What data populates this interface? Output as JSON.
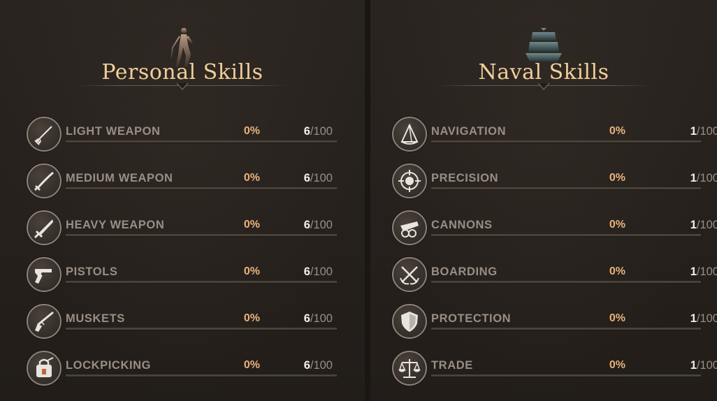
{
  "personal": {
    "title": "Personal Skills",
    "header_icon": "fencer-silhouette-icon",
    "skills": [
      {
        "name": "LIGHT WEAPON",
        "percent": "0%",
        "level": "6",
        "max": "/100",
        "icon": "rapier-icon"
      },
      {
        "name": "MEDIUM WEAPON",
        "percent": "0%",
        "level": "6",
        "max": "/100",
        "icon": "saber-icon"
      },
      {
        "name": "HEAVY WEAPON",
        "percent": "0%",
        "level": "6",
        "max": "/100",
        "icon": "broadsword-icon"
      },
      {
        "name": "PISTOLS",
        "percent": "0%",
        "level": "6",
        "max": "/100",
        "icon": "pistol-icon"
      },
      {
        "name": "MUSKETS",
        "percent": "0%",
        "level": "6",
        "max": "/100",
        "icon": "musket-icon"
      },
      {
        "name": "LOCKPICKING",
        "percent": "0%",
        "level": "6",
        "max": "/100",
        "icon": "lockpick-icon"
      }
    ]
  },
  "naval": {
    "title": "Naval Skills",
    "header_icon": "ship-icon",
    "skills": [
      {
        "name": "NAVIGATION",
        "percent": "0%",
        "level": "1",
        "max": "/100",
        "icon": "sextant-icon"
      },
      {
        "name": "PRECISION",
        "percent": "0%",
        "level": "1",
        "max": "/100",
        "icon": "crosshair-icon"
      },
      {
        "name": "CANNONS",
        "percent": "0%",
        "level": "1",
        "max": "/100",
        "icon": "cannon-icon"
      },
      {
        "name": "BOARDING",
        "percent": "0%",
        "level": "1",
        "max": "/100",
        "icon": "grappling-hook-icon"
      },
      {
        "name": "PROTECTION",
        "percent": "0%",
        "level": "1",
        "max": "/100",
        "icon": "shield-icon"
      },
      {
        "name": "TRADE",
        "percent": "0%",
        "level": "1",
        "max": "/100",
        "icon": "scales-icon"
      }
    ]
  },
  "colors": {
    "title": "#f0cf9a",
    "percent": "#e9b27c",
    "label": "#9a8e84",
    "background": "#241f1b"
  }
}
